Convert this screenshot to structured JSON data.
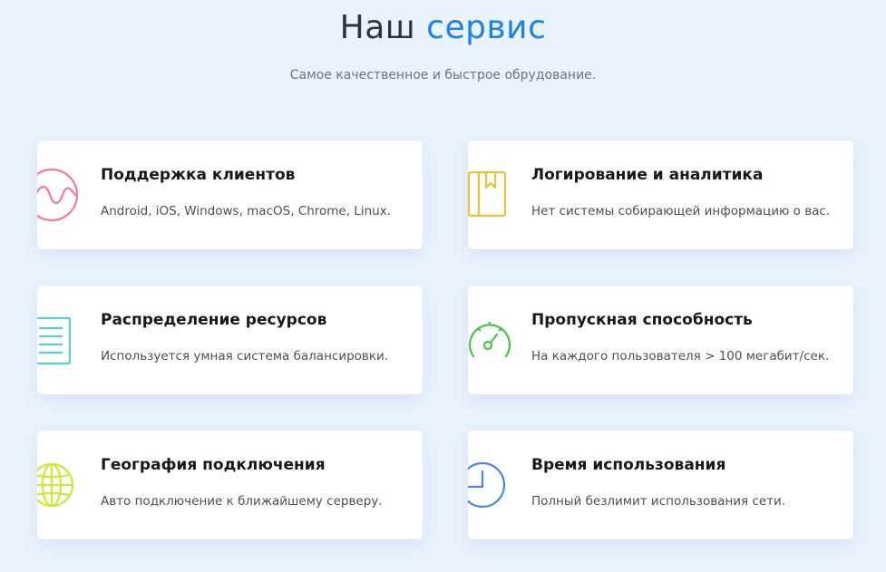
{
  "header": {
    "title_main": "Наш",
    "title_accent": "сервис",
    "subtitle": "Самое качественное и быстрое обрудование."
  },
  "colors": {
    "background": "#eaf3fd",
    "accent": "#1a82ec",
    "icon_support": "#f07aa0",
    "icon_logging": "#e8c33a",
    "icon_resources": "#5ccfcf",
    "icon_bandwidth": "#4ac24a",
    "icon_geo": "#c8ea3a",
    "icon_time": "#4a86e8"
  },
  "cards": [
    {
      "icon": "waveform-circle-icon",
      "title": "Поддержка клиентов",
      "description": "Android, iOS, Windows, macOS, Chrome, Linux."
    },
    {
      "icon": "book-bookmark-icon",
      "title": "Логирование и аналитика",
      "description": "Нет системы собирающей информацию о вас."
    },
    {
      "icon": "document-lines-icon",
      "title": "Распределение ресурсов",
      "description": "Используется умная система балансировки."
    },
    {
      "icon": "speedometer-icon",
      "title": "Пропускная способность",
      "description": "На каждого пользователя > 100 мегабит/сек."
    },
    {
      "icon": "globe-icon",
      "title": "География подключения",
      "description": "Авто подключение к ближайшему серверу."
    },
    {
      "icon": "clock-icon",
      "title": "Время использования",
      "description": "Полный безлимит использования сети."
    }
  ]
}
